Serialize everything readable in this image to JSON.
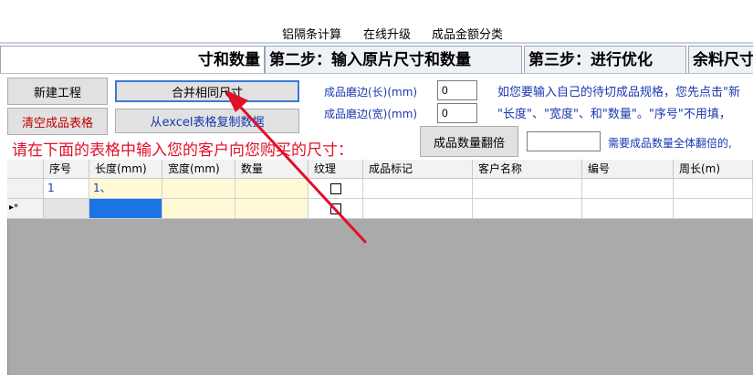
{
  "menu": {
    "items": [
      "铝隔条计算",
      "在线升级",
      "成品金额分类"
    ]
  },
  "tabs": [
    {
      "label": "寸和数量"
    },
    {
      "label": "第二步：输入原片尺寸和数量"
    },
    {
      "label": "第三步：进行优化"
    },
    {
      "label": "余料尺寸"
    }
  ],
  "toolbar": {
    "new_project": "新建工程",
    "merge_same": "合并相同尺寸",
    "clear_table": "清空成品表格",
    "copy_excel": "从excel表格复制数据",
    "double_qty": "成品数量翻倍"
  },
  "fields": {
    "grind_long_label": "成品磨边(长)(mm)",
    "grind_long_value": "0",
    "grind_wide_label": "成品磨边(宽)(mm)",
    "grind_wide_value": "0",
    "double_value": ""
  },
  "hints": {
    "line1": "如您要输入自己的待切成品规格，您先点击\"新",
    "line2": "\"长度\"、\"宽度\"、和\"数量\"。\"序号\"不用填，",
    "line3": "需要成品数量全体翻倍的,"
  },
  "instruction": "请在下面的表格中输入您的客户向您购买的尺寸：",
  "table": {
    "columns": [
      "序号",
      "长度(mm)",
      "宽度(mm)",
      "数量",
      "纹理",
      "成品标记",
      "客户名称",
      "编号",
      "周长(m)"
    ],
    "rows": [
      {
        "index": "1",
        "length": "1、",
        "width": "",
        "qty": "",
        "mark": "",
        "customer": "",
        "code": "",
        "perimeter": ""
      }
    ],
    "new_row_marker": "▸*"
  }
}
